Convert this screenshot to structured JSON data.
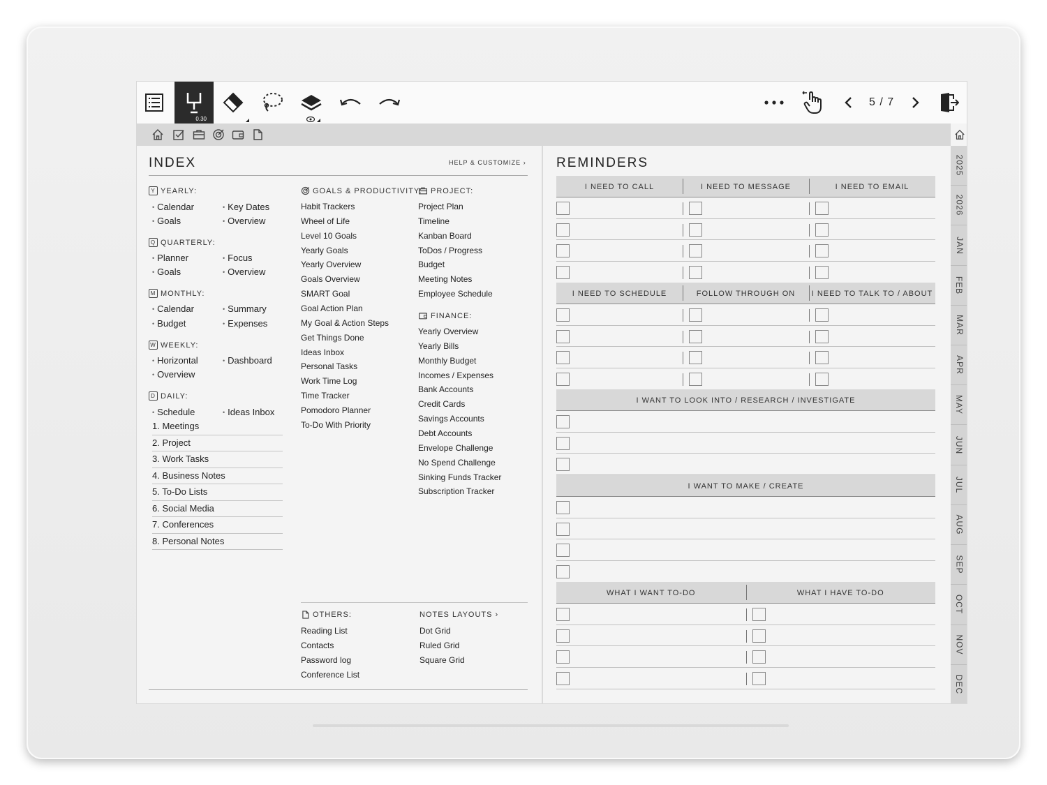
{
  "toolbar": {
    "pen_size": "0.30",
    "page_indicator": "5 / 7",
    "icons": [
      "toc-icon",
      "pen-icon",
      "eraser-icon",
      "lasso-icon",
      "layers-icon",
      "undo-icon",
      "redo-icon",
      "more-icon",
      "hand-gesture-icon",
      "prev-page-icon",
      "next-page-icon",
      "exit-icon"
    ]
  },
  "subnav": {
    "icons": [
      "home-icon",
      "todo-icon",
      "project-icon",
      "goals-icon",
      "finance-icon",
      "notes-icon"
    ]
  },
  "month_tabs": [
    "2025",
    "2026",
    "JAN",
    "FEB",
    "MAR",
    "APR",
    "MAY",
    "JUN",
    "JUL",
    "AUG",
    "SEP",
    "OCT",
    "NOV",
    "DEC"
  ],
  "index": {
    "title": "INDEX",
    "help": "HELP & CUSTOMIZE",
    "yearly": {
      "icon": "Y",
      "title": "YEARLY:",
      "col1": [
        "Calendar",
        "Goals"
      ],
      "col2": [
        "Key Dates",
        "Overview"
      ]
    },
    "quarterly": {
      "icon": "Q",
      "title": "QUARTERLY:",
      "col1": [
        "Planner",
        "Goals"
      ],
      "col2": [
        "Focus",
        "Overview"
      ]
    },
    "monthly": {
      "icon": "M",
      "title": "MONTHLY:",
      "col1": [
        "Calendar",
        "Budget"
      ],
      "col2": [
        "Summary",
        "Expenses"
      ]
    },
    "weekly": {
      "icon": "W",
      "title": "WEEKLY:",
      "col1": [
        "Horizontal",
        "Overview"
      ],
      "col2": [
        "Dashboard"
      ]
    },
    "daily": {
      "icon": "D",
      "title": "DAILY:",
      "col1": [
        "Schedule"
      ],
      "col2": [
        "Ideas Inbox"
      ]
    },
    "numbered": [
      "1. Meetings",
      "2. Project",
      "3. Work Tasks",
      "4. Business Notes",
      "5. To-Do Lists",
      "6. Social Media",
      "7. Conferences",
      "8. Personal Notes"
    ],
    "goals": {
      "title": "GOALS & PRODUCTIVITY:",
      "items": [
        "Habit Trackers",
        "Wheel of Life",
        "Level 10 Goals",
        "Yearly Goals",
        "Yearly Overview",
        "Goals Overview",
        "SMART Goal",
        "Goal Action Plan",
        "My Goal & Action Steps",
        "Get Things Done",
        "Ideas Inbox",
        "Personal Tasks",
        "Work Time Log",
        "Time Tracker",
        "Pomodoro Planner",
        "To-Do With Priority"
      ]
    },
    "project": {
      "title": "PROJECT:",
      "items": [
        "Project Plan",
        "Timeline",
        "Kanban Board",
        "ToDos / Progress",
        "Budget",
        "Meeting Notes",
        "Employee Schedule"
      ]
    },
    "finance": {
      "title": "FINANCE:",
      "items": [
        "Yearly Overview",
        "Yearly Bills",
        "Monthly Budget",
        "Incomes / Expenses",
        "Bank Accounts",
        "Credit Cards",
        "Savings Accounts",
        "Debt Accounts",
        "Envelope Challenge",
        "No Spend Challenge",
        "Sinking Funds Tracker",
        "Subscription Tracker"
      ]
    },
    "others": {
      "title": "OTHERS:",
      "items": [
        "Reading List",
        "Contacts",
        "Password log",
        "Conference List"
      ]
    },
    "notes_layouts": {
      "title": "NOTES LAYOUTS",
      "items": [
        "Dot Grid",
        "Ruled Grid",
        "Square Grid"
      ]
    }
  },
  "reminders": {
    "title": "REMINDERS",
    "band1": [
      "I NEED TO CALL",
      "I NEED TO MESSAGE",
      "I NEED TO EMAIL"
    ],
    "band2": [
      "I NEED TO SCHEDULE",
      "FOLLOW THROUGH ON",
      "I NEED TO TALK TO / ABOUT"
    ],
    "band3": [
      "I WANT TO LOOK INTO / RESEARCH / INVESTIGATE"
    ],
    "band4": [
      "I WANT TO MAKE / CREATE"
    ],
    "band5": [
      "WHAT I WANT TO-DO",
      "WHAT I HAVE TO-DO"
    ]
  }
}
